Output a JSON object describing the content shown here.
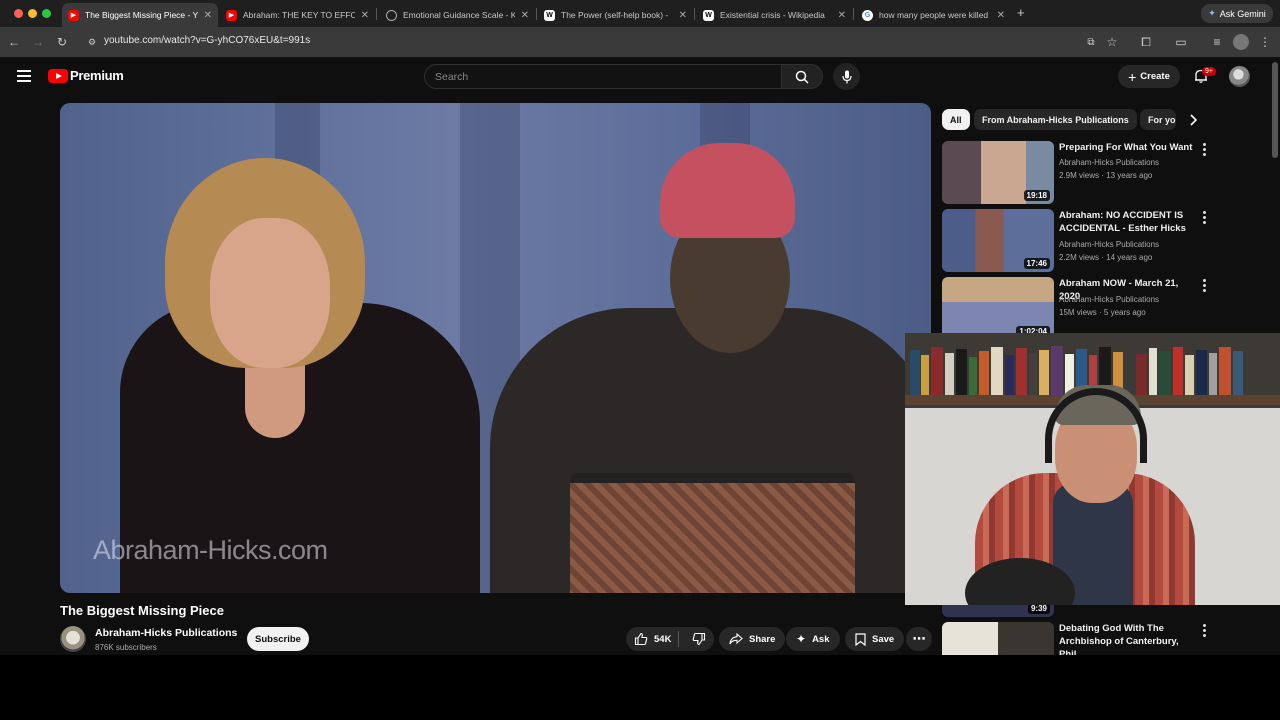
{
  "browser": {
    "tabs": [
      {
        "title": "The Biggest Missing Piece - Y",
        "favicon": "youtube",
        "active": true
      },
      {
        "title": "Abraham: THE KEY TO EFFO",
        "favicon": "youtube",
        "active": false
      },
      {
        "title": "Emotional Guidance Scale - K",
        "favicon": "globe",
        "active": false
      },
      {
        "title": "The Power (self-help book) -",
        "favicon": "wikipedia",
        "active": false
      },
      {
        "title": "Existential crisis - Wikipedia",
        "favicon": "wikipedia",
        "active": false
      },
      {
        "title": "how many people were killed",
        "favicon": "google",
        "active": false
      }
    ],
    "new_tab": "+",
    "ask_gemini": "Ask Gemini",
    "url": "youtube.com/watch?v=G-yhCO76xEU&t=991s"
  },
  "youtube": {
    "logo_text": "Premium",
    "search_placeholder": "Search",
    "create_label": "Create",
    "notifications_badge": "9+"
  },
  "video": {
    "watermark": "Abraham-Hicks.com",
    "title": "The Biggest Missing Piece",
    "channel": "Abraham-Hicks Publications",
    "subscribers": "876K subscribers",
    "subscribe_label": "Subscribe",
    "likes": "54K",
    "share_label": "Share",
    "ask_label": "Ask",
    "save_label": "Save"
  },
  "sidebar": {
    "chips": [
      "All",
      "From Abraham-Hicks Publications",
      "For yo"
    ],
    "recommendations": [
      {
        "title": "Preparing For What You Want",
        "channel": "Abraham-Hicks Publications",
        "meta": "2.9M views · 13 years ago",
        "duration": "19:18"
      },
      {
        "title": "Abraham: NO ACCIDENT IS ACCIDENTAL - Esther Hicks",
        "channel": "Abraham-Hicks Publications",
        "meta": "2.2M views · 14 years ago",
        "duration": "17:46"
      },
      {
        "title": "Abraham NOW - March 21, 2020",
        "channel": "Abraham-Hicks Publications",
        "meta": "15M views · 5 years ago",
        "duration": "1:02:04"
      },
      {
        "title": "",
        "channel": "",
        "meta": "",
        "duration": "9:39"
      },
      {
        "title": "Debating God With The Archbishop of Canterbury, Phil...",
        "channel": "",
        "meta": "",
        "duration": ""
      }
    ]
  },
  "colors": {
    "youtube_red": "#ff0000",
    "background": "#0f0f0f",
    "chip_bg": "#272727"
  }
}
